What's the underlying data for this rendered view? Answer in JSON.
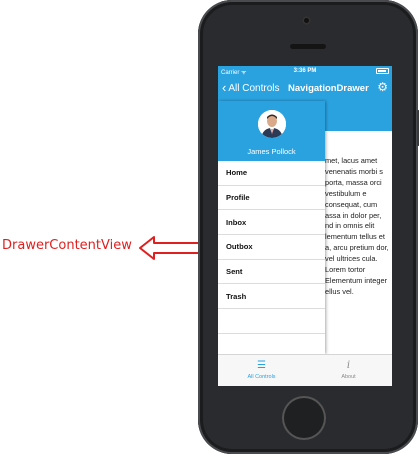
{
  "annotation": {
    "label": "DrawerContentView",
    "color": "#e02020"
  },
  "status_bar": {
    "carrier": "Carrier",
    "wifi_icon": "wifi-icon",
    "time": "3:36 PM",
    "battery_level": 0.9
  },
  "nav_bar": {
    "back_label": "All Controls",
    "title": "NavigationDrawer",
    "settings_icon": "gear-icon"
  },
  "colors": {
    "accent": "#2aa2e0"
  },
  "drawer": {
    "user_name": "James Pollock",
    "menu": [
      "Home",
      "Profile",
      "Inbox",
      "Outbox",
      "Sent",
      "Trash",
      ""
    ]
  },
  "content": {
    "text": "met, lacus amet venenatis morbi s porta, massa orci vestibulum e consequat, cum assa in dolor per, nd in omnis elit lementum tellus et a, arcu pretium dor, vel ultrices cula. Lorem tortor Elementum integer ellus vel."
  },
  "tab_bar": {
    "tabs": [
      {
        "label": "All Controls",
        "icon": "list-icon",
        "active": true
      },
      {
        "label": "About",
        "icon": "info-icon",
        "active": false
      }
    ]
  }
}
